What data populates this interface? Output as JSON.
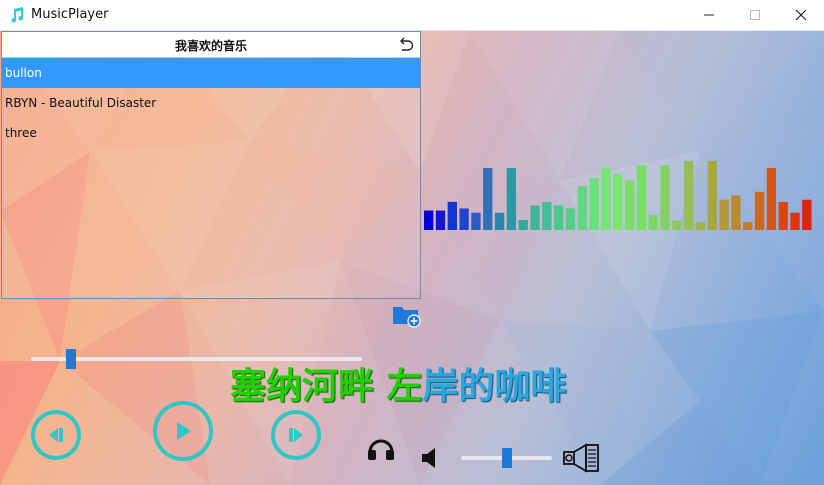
{
  "window": {
    "title": "MusicPlayer",
    "controls": [
      "minimize-icon",
      "maximize-icon",
      "close-icon"
    ]
  },
  "playlist": {
    "title": "我喜欢的音乐",
    "back_icon": "undo-icon",
    "items": [
      {
        "label": "bullon",
        "selected": true
      },
      {
        "label": "RBYN - Beautiful Disaster",
        "selected": false
      },
      {
        "label": "three",
        "selected": false
      }
    ]
  },
  "add_folder_icon": "folder-add-icon",
  "spectrum": {
    "levels": [
      0.27,
      0.27,
      0.39,
      0.3,
      0.24,
      0.86,
      0.24,
      0.86,
      0.14,
      0.34,
      0.39,
      0.34,
      0.3,
      0.61,
      0.72,
      0.86,
      0.78,
      0.69,
      0.9,
      0.21,
      0.9,
      0.13,
      0.96,
      0.11,
      0.96,
      0.42,
      0.48,
      0.11,
      0.53,
      0.86,
      0.39,
      0.24,
      0.42
    ],
    "colors": [
      "#0000d8",
      "#0f16d6",
      "#1236d0",
      "#1e46cc",
      "#2a5cc4",
      "#3070b8",
      "#2a86ae",
      "#2b98a6",
      "#36a89f",
      "#3fb598",
      "#45bf94",
      "#4cc78e",
      "#55cf87",
      "#60d880",
      "#6ae27a",
      "#74e675",
      "#7ee470",
      "#7edc6c",
      "#78de64",
      "#7ed664",
      "#84d062",
      "#8ec75c",
      "#96be54",
      "#9fb44c",
      "#a8a640",
      "#b29838",
      "#bb8a30",
      "#c47a28",
      "#cc6820",
      "#d35518",
      "#d84512",
      "#dc340c",
      "#e02208"
    ]
  },
  "progress": {
    "fraction": 0.12
  },
  "lyric": {
    "sung": "塞纳河畔 左",
    "unsung": "岸的咖啡"
  },
  "controls": {
    "prev_icon": "previous-icon",
    "play_icon": "play-icon",
    "next_icon": "next-icon",
    "headphone_icon": "headphones-icon",
    "volume_icon": "volume-icon",
    "volume": 0.5,
    "speaker_icon": "speaker-icon"
  },
  "colors": {
    "accent": "#2fc6c6",
    "selection": "#3399ff",
    "slider_thumb": "#1e7ad9",
    "lyric_sung": "#22d000",
    "lyric_unsung": "#2aa7de"
  }
}
